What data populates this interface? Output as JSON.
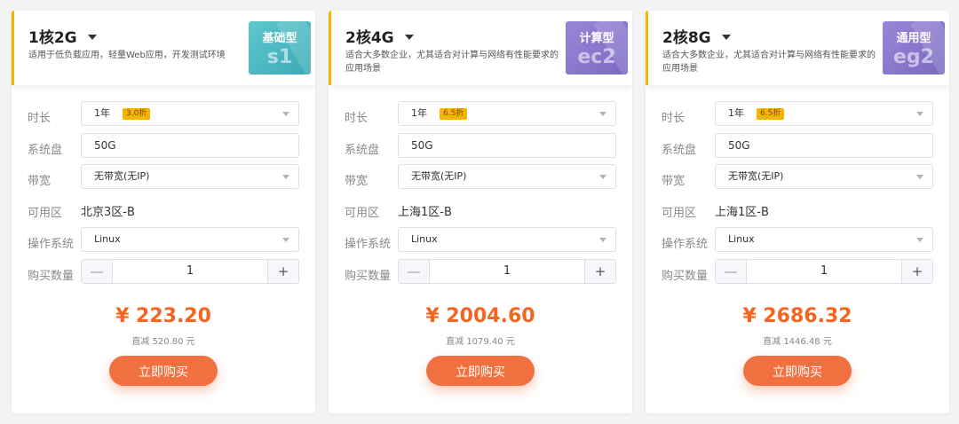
{
  "labels": {
    "duration": "时长",
    "disk": "系统盘",
    "bandwidth": "带宽",
    "zone": "可用区",
    "os": "操作系统",
    "qty": "购买数量"
  },
  "icons": {
    "dropdown": "chevron-down-icon",
    "minus": "minus-icon",
    "plus": "plus-icon"
  },
  "colors": {
    "accent": "#f5b400",
    "price": "#f26522",
    "buy": "#f07040"
  },
  "cards": [
    {
      "title": "1核2G",
      "desc": "适用于低负载应用，轻量Web应用，开发测试环境",
      "badge_title": "基础型",
      "badge_code": "s1",
      "duration": "1年",
      "discount": "3.0折",
      "disk": "50G",
      "bandwidth": "无带宽(无IP)",
      "zone": "北京3区-B",
      "os": "Linux",
      "minus": "—",
      "qty": "1",
      "plus": "+",
      "price": "¥ 223.20",
      "saving": "直减 520.80 元",
      "buy": "立即购买"
    },
    {
      "title": "2核4G",
      "desc": "适合大多数企业，尤其适合对计算与网络有性能要求的应用场景",
      "badge_title": "计算型",
      "badge_code": "ec2",
      "duration": "1年",
      "discount": "6.5折",
      "disk": "50G",
      "bandwidth": "无带宽(无IP)",
      "zone": "上海1区-B",
      "os": "Linux",
      "minus": "—",
      "qty": "1",
      "plus": "+",
      "price": "¥ 2004.60",
      "saving": "直减 1079.40 元",
      "buy": "立即购买"
    },
    {
      "title": "2核8G",
      "desc": "适合大多数企业，尤其适合对计算与网络有性能要求的应用场景",
      "badge_title": "通用型",
      "badge_code": "eg2",
      "duration": "1年",
      "discount": "6.5折",
      "disk": "50G",
      "bandwidth": "无带宽(无IP)",
      "zone": "上海1区-B",
      "os": "Linux",
      "minus": "—",
      "qty": "1",
      "plus": "+",
      "price": "¥ 2686.32",
      "saving": "直减 1446.48 元",
      "buy": "立即购买"
    }
  ]
}
